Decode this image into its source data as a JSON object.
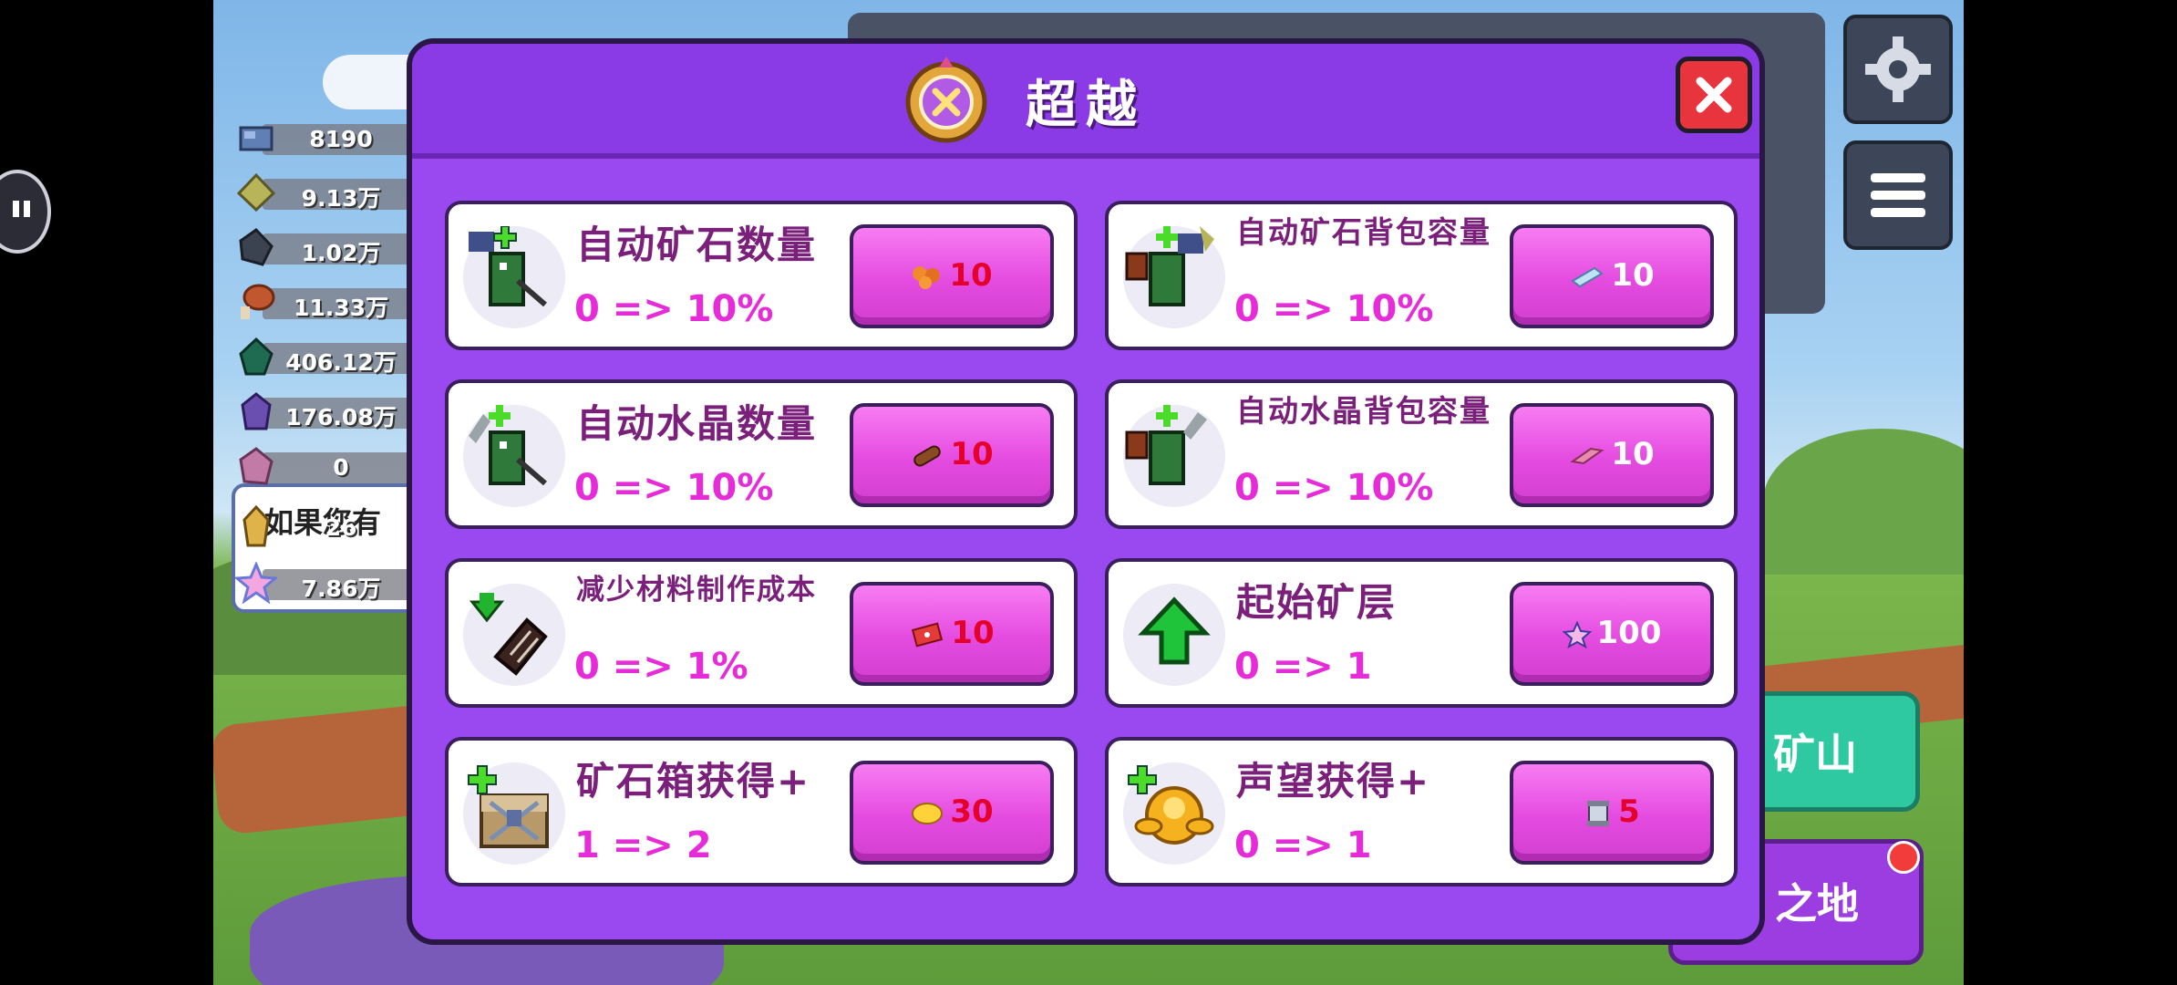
{
  "resources": [
    {
      "icon": "iron-ore-icon",
      "value": "8190"
    },
    {
      "icon": "gold-ore-icon",
      "value": "9.13万"
    },
    {
      "icon": "coal-ore-icon",
      "value": "1.02万"
    },
    {
      "icon": "meat-icon",
      "value": "11.33万"
    },
    {
      "icon": "emerald-icon",
      "value": "406.12万"
    },
    {
      "icon": "amethyst-icon",
      "value": "176.08万"
    },
    {
      "icon": "pink-crystal-icon",
      "value": "0"
    },
    {
      "icon": "gold-crystal-icon",
      "value": "26"
    },
    {
      "icon": "rainbow-star-icon",
      "value": "7.86万"
    }
  ],
  "hint_text": "如果您有",
  "right_buttons": {
    "mine": "矿山",
    "land": "之地"
  },
  "modal": {
    "title": "超越",
    "cards": [
      {
        "title": "自动矿石数量",
        "change": "0 => 10%",
        "cost": "10",
        "cost_icon": "orange-ore-icon"
      },
      {
        "title": "自动矿石背包容量",
        "change": "0 => 10%",
        "cost": "10",
        "cost_icon": "blue-crystal-icon"
      },
      {
        "title": "自动水晶数量",
        "change": "0 => 10%",
        "cost": "10",
        "cost_icon": "wood-log-icon"
      },
      {
        "title": "自动水晶背包容量",
        "change": "0 => 10%",
        "cost": "10",
        "cost_icon": "pink-gem-icon"
      },
      {
        "title": "减少材料制作成本",
        "change": "0 => 1%",
        "cost": "10",
        "cost_icon": "red-ticket-icon"
      },
      {
        "title": "起始矿层",
        "change": "0 => 1",
        "cost": "100",
        "cost_icon": "star-gem-icon"
      },
      {
        "title": "矿石箱获得+",
        "change": "1 => 2",
        "cost": "30",
        "cost_icon": "gold-coin-icon"
      },
      {
        "title": "声望获得+",
        "change": "0 => 1",
        "cost": "5",
        "cost_icon": "scroll-icon"
      }
    ]
  },
  "colors": {
    "modal": "#9a48f0",
    "button": "#e44be0",
    "title_text": "#7a1f7a",
    "change_text": "#e62bd8",
    "cost_text": "#e4002b"
  }
}
